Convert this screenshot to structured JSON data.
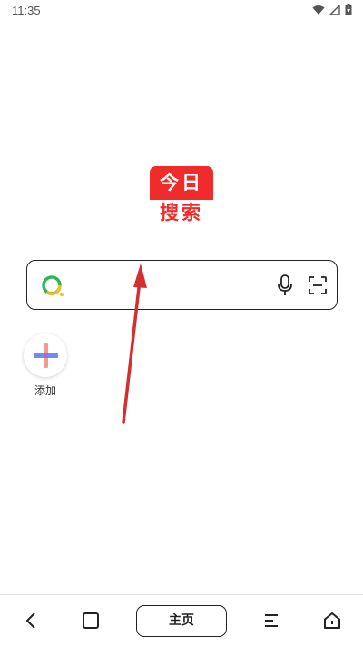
{
  "status_bar": {
    "time": "11:35",
    "icons": [
      "wifi-icon",
      "signal-icon",
      "battery-charging-icon"
    ]
  },
  "logo": {
    "line1": "今日",
    "line2": "搜索",
    "brand_color": "#f02b2b"
  },
  "search": {
    "value": "",
    "placeholder": "",
    "icons": [
      "search-logo-icon",
      "mic-icon",
      "scan-icon"
    ]
  },
  "shortcuts": [
    {
      "label": "添加",
      "icon": "plus-icon"
    }
  ],
  "bottom_nav": {
    "home_label": "主页",
    "icons": [
      "back-icon",
      "tabs-icon",
      "menu-icon",
      "home-icon"
    ]
  },
  "annotation": {
    "arrow_color": "#d32f2f"
  }
}
